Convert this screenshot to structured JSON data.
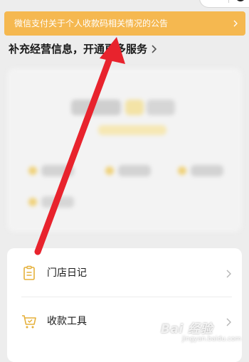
{
  "banner": {
    "text": "微信支付关于个人收款码相关情况的公告",
    "chevron_icon": "chevron-right-icon",
    "color": "#f5b850"
  },
  "promo": {
    "text": "补充经营信息，开通更多服务",
    "chevron_icon": "chevron-right-icon"
  },
  "menu": {
    "items": [
      {
        "label": "门店日记",
        "icon": "clipboard-icon"
      },
      {
        "label": "收款工具",
        "icon": "cart-check-icon"
      }
    ],
    "icon_color": "#e5b03a"
  },
  "annotation": {
    "color": "#e8232d"
  },
  "watermark": {
    "line1": "Bai 经验",
    "line2": "jingyan.baidu.com"
  }
}
